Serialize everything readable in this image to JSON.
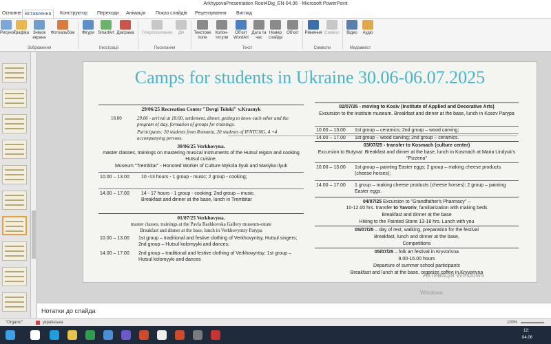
{
  "window": {
    "title": "ArkhypovaPresentation Root4Dig_EN-04.06  -  Microsoft PowerPoint"
  },
  "tabs": [
    "Основне",
    "Вставлення",
    "Конструктор",
    "Переходи",
    "Анімація",
    "Показ слайдів",
    "Рецензування",
    "Вигляд"
  ],
  "ribbon": {
    "buttons": [
      "Рисунок",
      "Графіка",
      "Знімок екрана",
      "Фотоальбом",
      "Фігури",
      "SmartArt",
      "Діаграма",
      "Гіперпосилання",
      "Дія",
      "Текстове поле",
      "Колон- титули",
      "Об'єкт WordArt",
      "Дата та час",
      "Номер слайда",
      "Об'єкт",
      "Рівняння",
      "Символ",
      "Відео",
      "Аудіо"
    ],
    "groups": [
      "Зображення",
      "Ілюстрації",
      "Посилання",
      "Текст",
      "Символи",
      "Медіавміст"
    ]
  },
  "slide": {
    "title": "Camps for students in Ukraine 30.06-06.07.2025",
    "left": {
      "d1_head": "29/06/25 Recreation Center \"Dovgi Toloki\" v.Krasnyk",
      "d1_time": "18.00",
      "d1_text": "29.06 - arrival at 18:00, settlement, dinner, getting to know each other and the program of stay, formation of groups for trainings.",
      "d1_part": "Participants: 20 students from Romania, 20 students of IFNTUNG, 4 +4 accompanying persons.",
      "d2_head": "30/06/25 Verkhovyna.",
      "d2_text1": "master classes, trainings on mastering musical instruments of the Hutsul region and cooking Hutsul cuisine.",
      "d2_text2": "Museum \"Trembitar\" - Honored Worker of Culture Mykola Ilyuk and Mariyka Ilyuk",
      "d2_r1_time": "10.00 – 13.00",
      "d2_r1_text": "10 -13 hours - 1 group - music; 2 group - cooking;",
      "d2_r2_time": "14.00 – 17.00",
      "d2_r2_text": "14 - 17 hours - 1 group - cooking; 2nd group – music.",
      "d2_r2_text2": "Breakfast and dinner at the base, lunch in Trembitar",
      "d3_head": "01/07/25 Verkhovyna.",
      "d3_text1": "master classes, trainings at the Pavla Rashkovska Gallery museum-estate",
      "d3_text2": "Breakfast and dinner at the base, lunch in Verkhovyntsy Parypa",
      "d3_r1_time": "10.00 – 13.00",
      "d3_r1_text": "1st group – traditional and festive clothing of Verkhovyntsy, Hutsul singers; 2nd group – Hutsul kolomyyki and dances;",
      "d3_r2_time": "14.00 – 17.00",
      "d3_r2_text": "2nd group – traditional and festive clothing of Verkhovyntsy; 1st group – Hutsul kolomyyki and dances"
    },
    "right": {
      "d4_head": "02/07/25 - moving to Kosiv (Institute of Applied and Decorative Arts)",
      "d4_text": "Excursion to the institute museum. Breakfast and dinner at the base, lunch in Kosov Parypa",
      "d4_r1_time": "10.00 – 13.00",
      "d4_r1_text": "1st group – ceramics; 2nd group – wood carving;",
      "d4_r2_time": "14.00 – 17.00",
      "d4_r2_text": "1st group – wood carving; 2nd group – ceramics.",
      "d5_head": "03/07/25 - transfer to Kosmach (culture center)",
      "d5_text": "Excursion to Butynar. Breakfast and dinner at the base, lunch in Kosmach at Maria Lindyuk's \"Pizzeria\"",
      "d5_r1_time": "10.00 – 13.00",
      "d5_r1_text": "1st group – painting Easter eggs; 2 group – making cheese products (cheese horses);",
      "d5_r2_time": "14.00 – 17.00",
      "d5_r2_text": "1 group – making cheese products (cheese horses); 2 group – painting Easter eggs.",
      "d6_head": "04/07/25",
      "d6_text1": "Excursion to \"Grandfather's Pharmacy\" –",
      "d6_text2a": "10-12.00 hrs. transfer",
      "d6_text2b": "to Yavoriv",
      "d6_text2c": ", familiarization with making beds",
      "d6_text3": "Breakfast and dinner at the base",
      "d6_text4": "Hiking to the Painted Stone 13-18 hrs. Lunch with you",
      "d7_head": "05/07/25",
      "d7_text1": " – day of rest, walking, preparation for the festival",
      "d7_text2": "Breakfast, lunch and dinner at the base,",
      "d7_text3": "Competitions",
      "d8_head": "05/07/25",
      "d8_text1": " – folk art festival in Kryvorivna",
      "d8_text2": "9.00-16.00 hours",
      "d8_text3": "Departure of summer school participants",
      "d8_text4": "Breakfast and lunch at the base, organize coffee in Kryvorivna"
    },
    "watermark1": "Активація Windows",
    "watermark2": "Windows."
  },
  "notes": {
    "placeholder": "Нотатки до слайда"
  },
  "status": {
    "theme": "\"Organic\"",
    "lang": "українська",
    "zoom": "100%",
    "time": "12:",
    "date": "04.06"
  },
  "colors": {
    "accent": "#2b579a",
    "title": "#4bb3c6",
    "taskbar": "#1f2b3a"
  }
}
